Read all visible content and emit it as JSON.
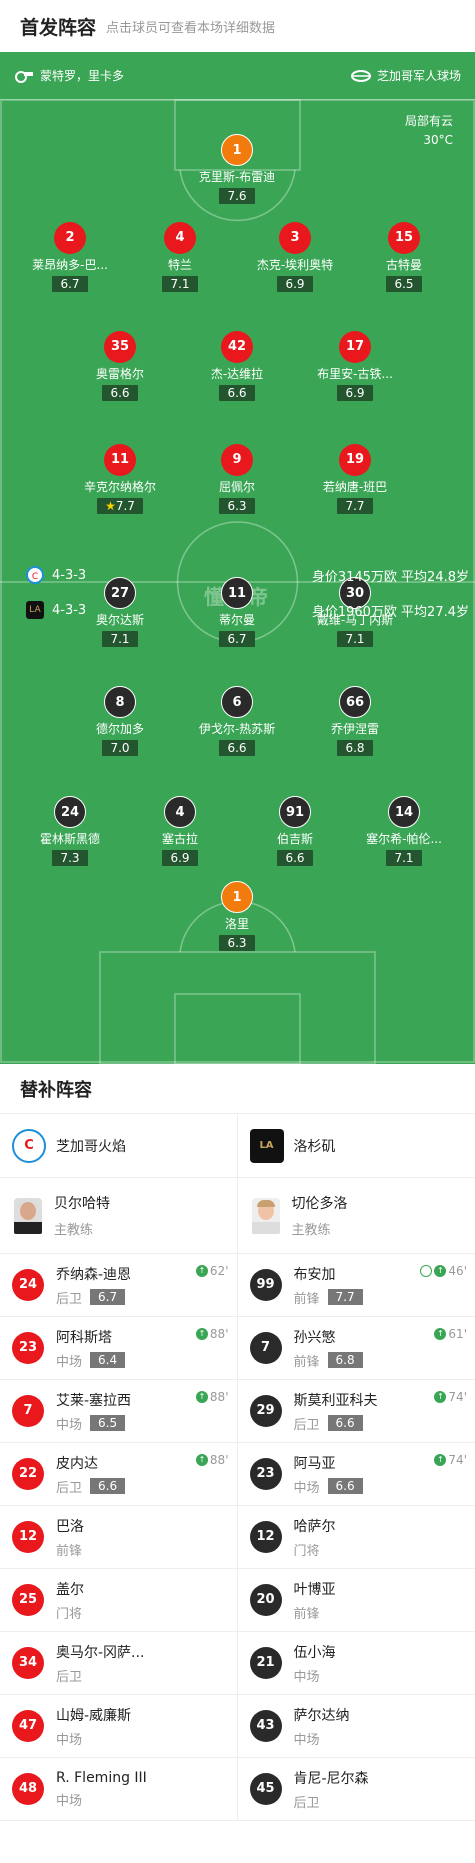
{
  "header": {
    "title": "首发阵容",
    "subtitle": "点击球员可查看本场详细数据"
  },
  "match": {
    "city": "蒙特罗，里卡多",
    "stadium": "芝加哥军人球场",
    "weather": "局部有云",
    "temperature": "30°C"
  },
  "watermark": "懂球帝",
  "home_team": {
    "name": "芝加哥火焰",
    "formation": "4-3-3",
    "summary": "身价3145万欧 平均24.8岁",
    "color": "#e8181c"
  },
  "away_team": {
    "name": "洛杉矶",
    "formation": "4-3-3",
    "summary": "身价1960万欧 平均27.4岁",
    "color": "#2a2a2a"
  },
  "home_players": [
    {
      "number": "1",
      "name": "克里斯-布雷迪",
      "rating": "7.6",
      "role": "gk",
      "yellow": true
    },
    {
      "number": "2",
      "name": "莱昂纳多-巴...",
      "rating": "6.7"
    },
    {
      "number": "4",
      "name": "特兰",
      "rating": "7.1",
      "yellow": true,
      "goal": true
    },
    {
      "number": "3",
      "name": "杰克-埃利奥特",
      "rating": "6.9",
      "captain": true
    },
    {
      "number": "15",
      "name": "古特曼",
      "rating": "6.5",
      "subout": "62'"
    },
    {
      "number": "35",
      "name": "奥雷格尔",
      "rating": "6.6",
      "subout": "88'"
    },
    {
      "number": "42",
      "name": "杰-达维拉",
      "rating": "6.6",
      "subout": "88'"
    },
    {
      "number": "17",
      "name": "布里安-古铁...",
      "rating": "6.9",
      "yellow": true
    },
    {
      "number": "11",
      "name": "辛克尔纳格尔",
      "rating": "7.7",
      "yellow": true,
      "subout": "88'",
      "star": true,
      "assist": true
    },
    {
      "number": "9",
      "name": "屈佩尔",
      "rating": "6.3"
    },
    {
      "number": "19",
      "name": "若纳唐-班巴",
      "rating": "7.7",
      "goal": true
    }
  ],
  "away_players": [
    {
      "number": "27",
      "name": "奥尔达斯",
      "rating": "7.1"
    },
    {
      "number": "11",
      "name": "蒂尔曼",
      "rating": "6.7"
    },
    {
      "number": "30",
      "name": "戴维-马丁内斯",
      "rating": "7.1",
      "subout": "61'",
      "assist": true
    },
    {
      "number": "8",
      "name": "德尔加多",
      "rating": "7.0",
      "subout": "74'"
    },
    {
      "number": "6",
      "name": "伊戈尔-热苏斯",
      "rating": "6.6"
    },
    {
      "number": "66",
      "name": "乔伊涅雷",
      "rating": "6.8",
      "subout": "46'"
    },
    {
      "number": "24",
      "name": "霍林斯黑德",
      "rating": "7.3",
      "subout": "74'",
      "goal": true
    },
    {
      "number": "4",
      "name": "塞古拉",
      "rating": "6.9",
      "yellow": true
    },
    {
      "number": "91",
      "name": "伯吉斯",
      "rating": "6.6",
      "yellow": true
    },
    {
      "number": "14",
      "name": "塞尔希-帕伦...",
      "rating": "7.1"
    },
    {
      "number": "1",
      "name": "洛里",
      "rating": "6.3",
      "role": "gk",
      "captain": true
    }
  ],
  "subs": {
    "title": "替补阵容",
    "home": {
      "team": "芝加哥火焰",
      "coach": {
        "name": "贝尔哈特",
        "role": "主教练"
      },
      "players": [
        {
          "number": "24",
          "name": "乔纳森-迪恩",
          "pos": "后卫",
          "rating": "6.7",
          "in": "62'"
        },
        {
          "number": "23",
          "name": "阿科斯塔",
          "pos": "中场",
          "rating": "6.4",
          "in": "88'"
        },
        {
          "number": "7",
          "name": "艾莱-塞拉西",
          "pos": "中场",
          "rating": "6.5",
          "in": "88'"
        },
        {
          "number": "22",
          "name": "皮内达",
          "pos": "后卫",
          "rating": "6.6",
          "in": "88'"
        },
        {
          "number": "12",
          "name": "巴洛",
          "pos": "前锋"
        },
        {
          "number": "25",
          "name": "盖尔",
          "pos": "门将"
        },
        {
          "number": "34",
          "name": "奥马尔-冈萨...",
          "pos": "后卫"
        },
        {
          "number": "47",
          "name": "山姆-威廉斯",
          "pos": "中场"
        },
        {
          "number": "48",
          "name": "R. Fleming III",
          "pos": "中场"
        }
      ]
    },
    "away": {
      "team": "洛杉矶",
      "coach": {
        "name": "切伦多洛",
        "role": "主教练"
      },
      "players": [
        {
          "number": "99",
          "name": "布安加",
          "pos": "前锋",
          "rating": "7.7",
          "in": "46'",
          "goal": true
        },
        {
          "number": "7",
          "name": "孙兴慜",
          "pos": "前锋",
          "rating": "6.8",
          "in": "61'"
        },
        {
          "number": "29",
          "name": "斯莫利亚科夫",
          "pos": "后卫",
          "rating": "6.6",
          "in": "74'"
        },
        {
          "number": "23",
          "name": "阿马亚",
          "pos": "中场",
          "rating": "6.6",
          "in": "74'"
        },
        {
          "number": "12",
          "name": "哈萨尔",
          "pos": "门将"
        },
        {
          "number": "20",
          "name": "叶博亚",
          "pos": "前锋"
        },
        {
          "number": "21",
          "name": "伍小海",
          "pos": "中场"
        },
        {
          "number": "43",
          "name": "萨尔达纳",
          "pos": "中场"
        },
        {
          "number": "45",
          "name": "肯尼-尼尔森",
          "pos": "后卫"
        }
      ]
    }
  }
}
